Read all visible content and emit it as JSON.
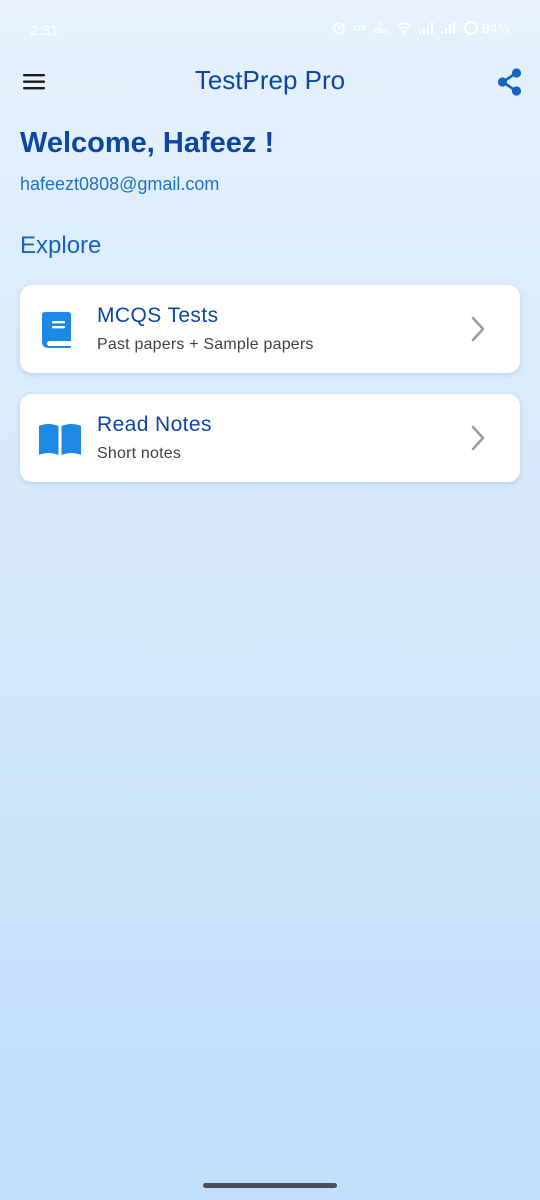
{
  "status_bar": {
    "time": "2:31",
    "icons": [
      "alarm-icon",
      "volte-icon",
      "network-speed-icon",
      "wifi-icon",
      "signal-icon",
      "signal-icon",
      "battery-icon"
    ],
    "lte_label": "LTE",
    "speed_value": "0",
    "speed_unit": "KB/s",
    "battery_percent": "94%"
  },
  "app_bar": {
    "title": "TestPrep Pro",
    "menu_icon": "menu-icon",
    "share_icon": "share-icon"
  },
  "welcome": {
    "greeting": "Welcome, Hafeez !",
    "email": "hafeezt0808@gmail.com"
  },
  "explore": {
    "heading": "Explore",
    "items": [
      {
        "title": "MCQS Tests",
        "subtitle": "Past papers + Sample papers",
        "icon": "book-icon"
      },
      {
        "title": "Read Notes",
        "subtitle": "Short notes",
        "icon": "open-book-icon"
      }
    ]
  },
  "colors": {
    "primary": "#0d47a1",
    "accent": "#1e88e5",
    "link": "#1e73be",
    "background_top": "#e6f1fd",
    "background_bottom": "#bfdffb",
    "card": "#ffffff",
    "subtitle": "#424242",
    "chevron": "#9e9e9e"
  }
}
